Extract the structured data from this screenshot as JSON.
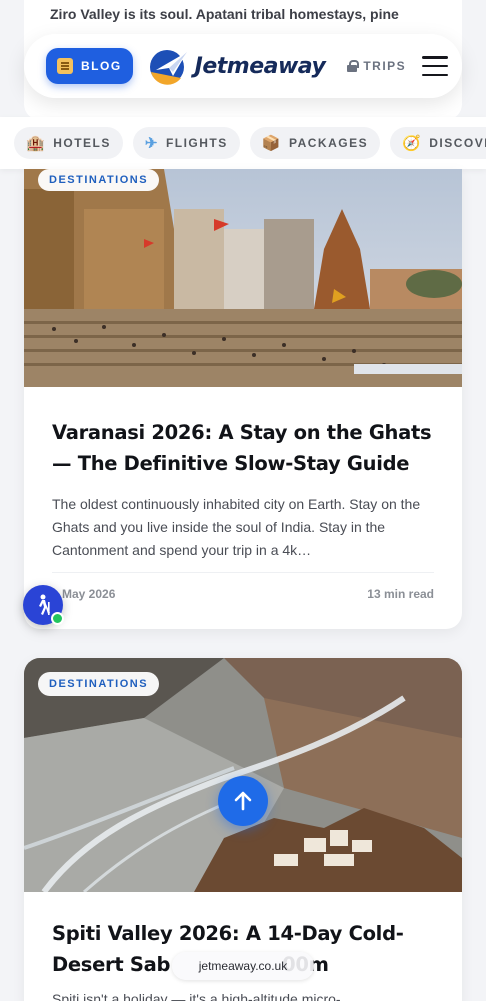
{
  "prev_card": {
    "text": "Ziro Valley is its soul. Apatani tribal homestays, pine"
  },
  "header": {
    "blog_label": "BLOG",
    "logo_text": "Jetmeaway",
    "trips_label": "TRIPS"
  },
  "nav": {
    "items": [
      {
        "label": "HOTELS",
        "icon": "hotel-icon",
        "glyph": "🏨"
      },
      {
        "label": "FLIGHTS",
        "icon": "plane-icon",
        "glyph": "✈"
      },
      {
        "label": "PACKAGES",
        "icon": "package-icon",
        "glyph": "📦"
      },
      {
        "label": "DISCOVER",
        "icon": "compass-icon",
        "glyph": "🧭"
      }
    ]
  },
  "articles": [
    {
      "category": "DESTINATIONS",
      "title": "Varanasi 2026: A Stay on the Ghats — The Definitive Slow-Stay Guide",
      "excerpt": "The oldest continuously inhabited city on Earth. Stay on the Ghats and you live inside the soul of India. Stay in the Cantonment and spend your trip in a 4k…",
      "date": "May 2026",
      "read_time": "13 min read"
    },
    {
      "category": "DESTINATIONS",
      "title": "Spiti Valley 2026: A 14-Day Cold-Desert Sab",
      "title_tail": "00m",
      "excerpt": "Spiti isn't a holiday — it's a high-altitude micro-"
    }
  ],
  "url": "jetmeaway.co.uk",
  "colors": {
    "primary": "#1f5fe0",
    "text_dark": "#111318",
    "badge_text": "#1f5fbe",
    "online_dot": "#22c55e"
  }
}
